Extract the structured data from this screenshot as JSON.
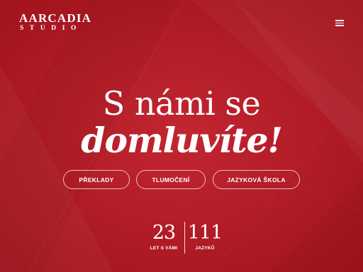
{
  "logo": {
    "name": "AARCADIA",
    "subtitle": "STUDIO"
  },
  "header": {
    "menu_icon": "hamburger-menu-icon"
  },
  "hero": {
    "line1": "S námi se",
    "line2": "domluvíte!"
  },
  "services": [
    {
      "label": "PŘEKLADY"
    },
    {
      "label": "TLUMOČENÍ"
    },
    {
      "label": "JAZYKOVÁ ŠKOLA"
    }
  ],
  "stats": [
    {
      "value": "23",
      "label": "LET S VÁMI"
    },
    {
      "value": "111",
      "label": "JAZYKŮ"
    }
  ],
  "colors": {
    "background": "#b61c26",
    "text": "#ffffff"
  }
}
